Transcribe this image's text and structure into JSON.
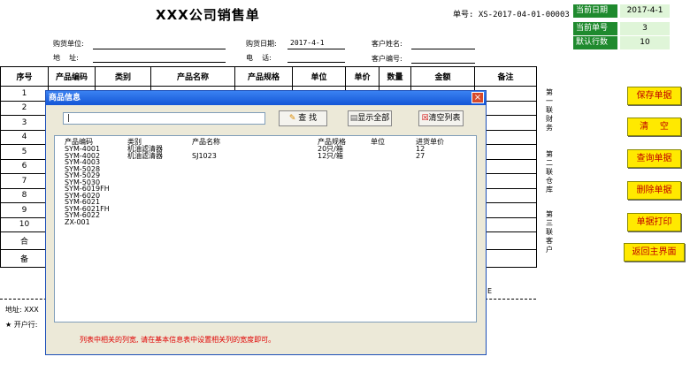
{
  "header": {
    "title": "XXX公司销售单",
    "doc_no_label": "单号:",
    "doc_no": "XS-2017-04-01-00003"
  },
  "side_panel": {
    "rows": [
      {
        "label": "当前日期",
        "value": "2017-4-1"
      },
      {
        "label": "当前单号",
        "value": "3"
      },
      {
        "label": "默认行数",
        "value": "10"
      }
    ]
  },
  "form": {
    "buyer_label": "购货单位:",
    "address_label": "地    址:",
    "date_label": "购货日期:",
    "date_value": "2017-4-1",
    "phone_label": "电    话:",
    "customer_name_label": "客户姓名:",
    "customer_no_label": "客户编号:"
  },
  "table": {
    "headers": [
      "序号",
      "产品编码",
      "类别",
      "产品名称",
      "产品规格",
      "单位",
      "单价",
      "数量",
      "金额",
      "备注"
    ],
    "rows": [
      "1",
      "2",
      "3",
      "4",
      "5",
      "6",
      "7",
      "8",
      "9",
      "10"
    ],
    "total_label": "合",
    "remark_label": "备"
  },
  "footer": {
    "address_label": "地址: XXX",
    "bank_label": "★ 开户行:",
    "partial_text": "E"
  },
  "copies": {
    "first": "第一联财务",
    "second": "第二联仓库",
    "third": "第三联客户"
  },
  "buttons": {
    "save": "保存单据",
    "clear": "清    空",
    "query": "查询单据",
    "delete": "删除单据",
    "print": "单据打印",
    "home": "返回主界面"
  },
  "dialog": {
    "title": "商品信息",
    "search_value": "|",
    "find_button": "查 找",
    "show_all_button": "显示全部",
    "clear_list_button": "清空列表",
    "note": "列表中相关的列宽, 请在基本信息表中设置相关列的宽度即可。",
    "list": {
      "headers": [
        "产品编码",
        "类别",
        "产品名称",
        "产品规格",
        "单位",
        "进货单价"
      ],
      "codes": [
        "SYM-4001",
        "SYM-4002",
        "SYM-4003",
        "SYM-5028",
        "SYM-5029",
        "SYM-5030",
        "SYM-6019FH",
        "SYM-6020",
        "SYM-6021",
        "SYM-6021FH",
        "SYM-6022",
        "ZX-001"
      ],
      "categories": [
        "机油滤清器",
        "机油滤清器"
      ],
      "names": [
        "",
        "SJ1023"
      ],
      "specs": [
        "20只/箱",
        "12只/箱"
      ],
      "prices": [
        "12",
        "27"
      ]
    }
  }
}
